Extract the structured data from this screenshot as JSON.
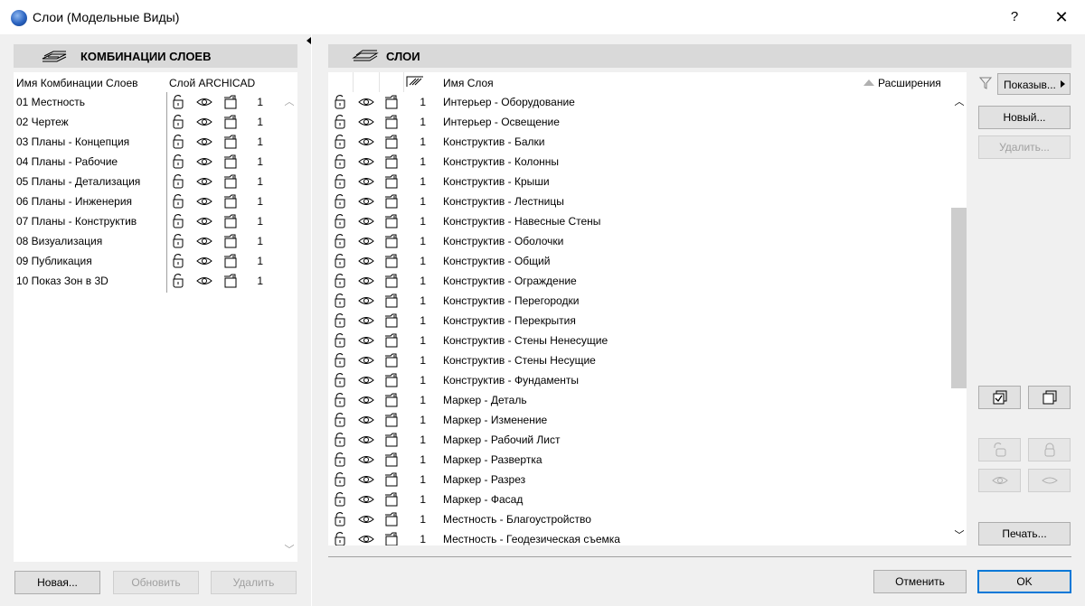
{
  "window": {
    "title": "Слои (Модельные Виды)",
    "help": "?",
    "close": "✕"
  },
  "left": {
    "header": "КОМБИНАЦИИ СЛОЕВ",
    "col_name": "Имя Комбинации Слоев",
    "col_layer": "Слой ARCHICAD",
    "rows": [
      {
        "name": "01 Местность",
        "num": "1"
      },
      {
        "name": "02 Чертеж",
        "num": "1"
      },
      {
        "name": "03 Планы - Концепция",
        "num": "1"
      },
      {
        "name": "04 Планы - Рабочие",
        "num": "1"
      },
      {
        "name": "05 Планы - Детализация",
        "num": "1"
      },
      {
        "name": "06 Планы - Инженерия",
        "num": "1"
      },
      {
        "name": "07 Планы - Конструктив",
        "num": "1"
      },
      {
        "name": "08 Визуализация",
        "num": "1"
      },
      {
        "name": "09 Публикация",
        "num": "1"
      },
      {
        "name": "10 Показ Зон в 3D",
        "num": "1"
      }
    ],
    "buttons": {
      "new": "Новая...",
      "update": "Обновить",
      "delete": "Удалить"
    }
  },
  "right": {
    "header": "СЛОИ",
    "col_name": "Имя Слоя",
    "col_ext": "Расширения",
    "rows": [
      {
        "name": "Интерьер - Оборудование",
        "num": "1"
      },
      {
        "name": "Интерьер - Освещение",
        "num": "1"
      },
      {
        "name": "Конструктив - Балки",
        "num": "1"
      },
      {
        "name": "Конструктив - Колонны",
        "num": "1"
      },
      {
        "name": "Конструктив - Крыши",
        "num": "1"
      },
      {
        "name": "Конструктив - Лестницы",
        "num": "1"
      },
      {
        "name": "Конструктив - Навесные Стены",
        "num": "1"
      },
      {
        "name": "Конструктив - Оболочки",
        "num": "1"
      },
      {
        "name": "Конструктив - Общий",
        "num": "1"
      },
      {
        "name": "Конструктив - Ограждение",
        "num": "1"
      },
      {
        "name": "Конструктив - Перегородки",
        "num": "1"
      },
      {
        "name": "Конструктив - Перекрытия",
        "num": "1"
      },
      {
        "name": "Конструктив - Стены Ненесущие",
        "num": "1"
      },
      {
        "name": "Конструктив - Стены Несущие",
        "num": "1"
      },
      {
        "name": "Конструктив - Фундаменты",
        "num": "1"
      },
      {
        "name": "Маркер - Деталь",
        "num": "1"
      },
      {
        "name": "Маркер - Изменение",
        "num": "1"
      },
      {
        "name": "Маркер - Рабочий Лист",
        "num": "1"
      },
      {
        "name": "Маркер - Развертка",
        "num": "1"
      },
      {
        "name": "Маркер - Разрез",
        "num": "1"
      },
      {
        "name": "Маркер - Фасад",
        "num": "1"
      },
      {
        "name": "Местность - Благоустройство",
        "num": "1"
      },
      {
        "name": "Местность - Геодезическая съемка",
        "num": "1"
      }
    ],
    "show_dropdown": "Показыв...",
    "buttons": {
      "new": "Новый...",
      "delete": "Удалить...",
      "print": "Печать..."
    }
  },
  "footer": {
    "cancel": "Отменить",
    "ok": "OK"
  },
  "colors": {
    "primary_border": "#0078d7",
    "panel_header": "#d9d9d9",
    "dialog_bg": "#f0f0f0"
  }
}
